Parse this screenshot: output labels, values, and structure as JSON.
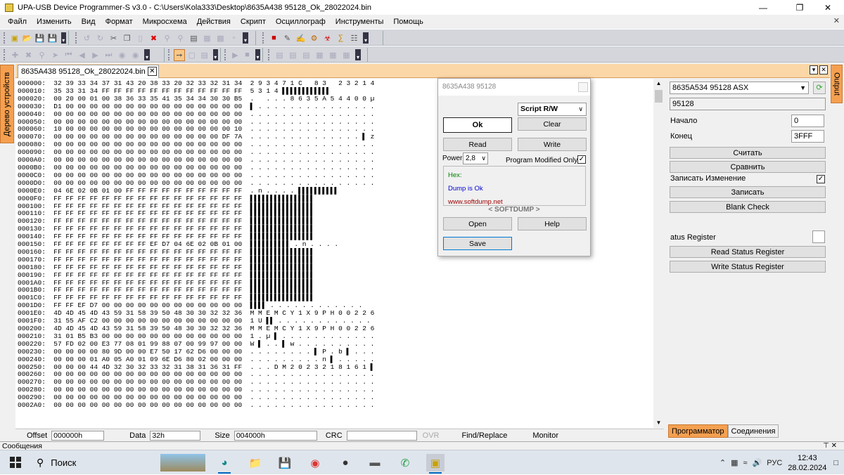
{
  "window": {
    "title": "UPA-USB Device Programmer-S v3.0 - C:\\Users\\Kola333\\Desktop\\8635A438 95128_Ok_28022024.bin",
    "minimize_icon": "minimize-icon",
    "maximize_icon": "restore-icon",
    "close_icon": "close-icon"
  },
  "menu": [
    "Файл",
    "Изменить",
    "Вид",
    "Формат",
    "Микросхема",
    "Действия",
    "Скрипт",
    "Осциллограф",
    "Инструменты",
    "Помощь"
  ],
  "side_tabs": {
    "left": "Дерево устройств",
    "right": "Output"
  },
  "document_tab": "8635A438 95128_Ok_28022024.bin",
  "hex_lines": [
    "000000:  32 39 33 34 37 31 43 20 38 33 20 32 33 32 31 34  2 9 3 4 7 1 C   8 3   2 3 2 1 4",
    "000010:  35 33 31 34 FF FF FF FF FF FF FF FF FF FF FF FF  5 3 1 4 ▌▌▌▌▌▌▌▌▌▌▌▌",
    "000020:  00 20 00 01 00 38 36 33 35 41 35 34 34 30 30 B5  .   . . . 8 6 3 5 A 5 4 4 0 0 µ",
    "000030:  D1 00 00 00 00 00 00 00 00 00 00 00 00 00 00 00  ▌ . . . . . . . . . . . . . . .",
    "000040:  00 00 00 00 00 00 00 00 00 00 00 00 00 00 00 00  . . . . . . . . . . . . . . . .",
    "000050:  00 00 00 00 00 00 00 00 00 00 00 00 00 00 00 00  . . . . . . . . . . . . . . . .",
    "000060:  10 00 00 00 00 00 00 00 00 00 00 00 00 00 00 10  . . . . . . . . . . . . . . . .",
    "000070:  00 00 00 00 00 00 00 00 00 00 00 00 00 00 DF 7A  . . . . . . . . . . . . . . ▌ z",
    "000080:  00 00 00 00 00 00 00 00 00 00 00 00 00 00 00 00  . . . . . . . . . . . . . . . .",
    "000090:  00 00 00 00 00 00 00 00 00 00 00 00 00 00 00 00  . . . . . . . . . . . . . . . .",
    "0000A0:  00 00 00 00 00 00 00 00 00 00 00 00 00 00 00 00  . . . . . . . . . . . . . . . .",
    "0000B0:  00 00 00 00 00 00 00 00 00 00 00 00 00 00 00 00  . . . . . . . . . . . . . . . .",
    "0000C0:  00 00 00 00 00 00 00 00 00 00 00 00 00 00 00 00  . . . . . . . . . . . . . . . .",
    "0000D0:  00 00 00 00 00 00 00 00 00 00 00 00 00 00 00 00  . . . . . . . . . . . . . . . .",
    "0000E0:  04 6E 02 0B 01 00 FF FF FF FF FF FF FF FF FF FF  . n . . . . ▌▌▌▌▌▌▌▌▌▌",
    "0000F0:  FF FF FF FF FF FF FF FF FF FF FF FF FF FF FF FF  ▌▌▌▌▌▌▌▌▌▌▌▌▌▌▌▌",
    "000100:  FF FF FF FF FF FF FF FF FF FF FF FF FF FF FF FF  ▌▌▌▌▌▌▌▌▌▌▌▌▌▌▌▌",
    "000110:  FF FF FF FF FF FF FF FF FF FF FF FF FF FF FF FF  ▌▌▌▌▌▌▌▌▌▌▌▌▌▌▌▌",
    "000120:  FF FF FF FF FF FF FF FF FF FF FF FF FF FF FF FF  ▌▌▌▌▌▌▌▌▌▌▌▌▌▌▌▌",
    "000130:  FF FF FF FF FF FF FF FF FF FF FF FF FF FF FF FF  ▌▌▌▌▌▌▌▌▌▌▌▌▌▌▌▌",
    "000140:  FF FF FF FF FF FF FF FF FF FF FF FF FF FF FF FF  ▌▌▌▌▌▌▌▌▌▌▌▌▌▌▌▌",
    "000150:  FF FF FF FF FF FF FF FF EF D7 04 6E 02 0B 01 00  ▌▌▌▌▌▌▌▌▌▌ . n . . . .",
    "000160:  FF FF FF FF FF FF FF FF FF FF FF FF FF FF FF FF  ▌▌▌▌▌▌▌▌▌▌▌▌▌▌▌▌",
    "000170:  FF FF FF FF FF FF FF FF FF FF FF FF FF FF FF FF  ▌▌▌▌▌▌▌▌▌▌▌▌▌▌▌▌",
    "000180:  FF FF FF FF FF FF FF FF FF FF FF FF FF FF FF FF  ▌▌▌▌▌▌▌▌▌▌▌▌▌▌▌▌",
    "000190:  FF FF FF FF FF FF FF FF FF FF FF FF FF FF FF FF  ▌▌▌▌▌▌▌▌▌▌▌▌▌▌▌▌",
    "0001A0:  FF FF FF FF FF FF FF FF FF FF FF FF FF FF FF FF  ▌▌▌▌▌▌▌▌▌▌▌▌▌▌▌▌",
    "0001B0:  FF FF FF FF FF FF FF FF FF FF FF FF FF FF FF FF  ▌▌▌▌▌▌▌▌▌▌▌▌▌▌▌▌",
    "0001C0:  FF FF FF FF FF FF FF FF FF FF FF FF FF FF FF FF  ▌▌▌▌▌▌▌▌▌▌▌▌▌▌▌▌",
    "0001D0:  FF FF EF D7 00 00 00 00 00 00 00 00 00 00 00 00  ▌▌▌▌ . . . . . . . . . . . .",
    "0001E0:  4D 4D 45 4D 43 59 31 58 39 50 48 30 30 32 32 36  M M E M C Y 1 X 9 P H 0 0 2 2 6",
    "0001F0:  31 55 AF C2 00 00 00 00 00 00 00 00 00 00 00 00  1 U ▌▌ . . . . . . . . . . . .",
    "000200:  4D 4D 45 4D 43 59 31 58 39 50 48 30 30 32 32 36  M M E M C Y 1 X 9 P H 0 0 2 2 6",
    "000210:  31 01 B5 B3 00 00 00 00 00 00 00 00 00 00 00 00  1 . µ ▌ . . . . . . . . . . . .",
    "000220:  57 FD 02 00 E3 77 08 01 99 88 07 00 99 97 00 00  W ▌ . . ▌ w . . . . . . . . . .",
    "000230:  00 00 00 00 80 9D 00 00 E7 50 17 62 D6 00 00 00  . . . . . . . . ▌ P . b ▌ . . .",
    "000240:  00 00 00 01 A0 05 A0 01 09 6E D6 80 02 00 00 00  . . . . . . . . . n ▌ . . . . .",
    "000250:  00 00 00 44 4D 32 30 32 33 32 31 38 31 36 31 FF  . . . D M 2 0 2 3 2 1 8 1 6 1 ▌",
    "000260:  00 00 00 00 00 00 00 00 00 00 00 00 00 00 00 00  . . . . . . . . . . . . . . . .",
    "000270:  00 00 00 00 00 00 00 00 00 00 00 00 00 00 00 00  . . . . . . . . . . . . . . . .",
    "000280:  00 00 00 00 00 00 00 00 00 00 00 00 00 00 00 00  . . . . . . . . . . . . . . . .",
    "000290:  00 00 00 00 00 00 00 00 00 00 00 00 00 00 00 00  . . . . . . . . . . . . . . . .",
    "0002A0:  00 00 00 00 00 00 00 00 00 00 00 00 00 00 00 00  . . . . . . . . . . . . . . . ."
  ],
  "statusbar": {
    "offset_label": "Offset",
    "offset_value": "000000h",
    "data_label": "Data",
    "data_value": "32h",
    "size_label": "Size",
    "size_value": "004000h",
    "crc_label": "CRC",
    "ovr_label": "OVR",
    "find_label": "Find/Replace",
    "monitor_label": "Monitor"
  },
  "dialog": {
    "title": "8635A438 95128",
    "script_select": "Script R/W",
    "ok_label": "Ok",
    "clear_label": "Clear",
    "read_label": "Read",
    "write_label": "Write",
    "power_label": "Power",
    "power_value": "2,8",
    "program_modified_label": "Program Modified Only",
    "program_modified_checked": true,
    "log_hex": "Hex:",
    "log_status": "Dump is Ok",
    "log_site": "www.softdump.net",
    "brand": "< SOFTDUMP >",
    "open_label": "Open",
    "help_label": "Help",
    "save_label": "Save",
    "colors": {
      "hex": "#008000",
      "status": "#0000cc",
      "site": "#a00000",
      "save_border": "#0078d7"
    }
  },
  "right_panel": {
    "chip_select": "8635A534 95128 ASX",
    "chip_name": "95128",
    "start_label": "Начало",
    "start_value": "0",
    "end_label": "Конец",
    "end_value": "3FFF",
    "read_button": "Считать",
    "compare_button": "Сравнить",
    "write_changes_label": "Записать Изменение",
    "write_changes_checked": true,
    "write_button": "Записать",
    "blank_check_button": "Blank Check",
    "status_register_label": "atus Register",
    "read_status_button": "Read Status Register",
    "write_status_button": "Write Status Register",
    "tabs": [
      "Программатор",
      "Соединения"
    ]
  },
  "messages_bar": {
    "label": "Сообщения",
    "pin_icon": "pin-icon"
  },
  "taskbar": {
    "search_placeholder": "Поиск",
    "apps": [
      "edge-icon",
      "file-explorer-icon",
      "save-disk-icon",
      "chrome-icon",
      "media-icon",
      "device-icon",
      "whatsapp-icon",
      "upa-programmer-icon"
    ],
    "tray_lang": "РУС",
    "time": "12:43",
    "date": "28.02.2024"
  },
  "accent_colors": {
    "orange_tab": "#f5a050",
    "doc_tab_bar": "#fbd7a8",
    "toolbar": "#d4d6dc"
  }
}
